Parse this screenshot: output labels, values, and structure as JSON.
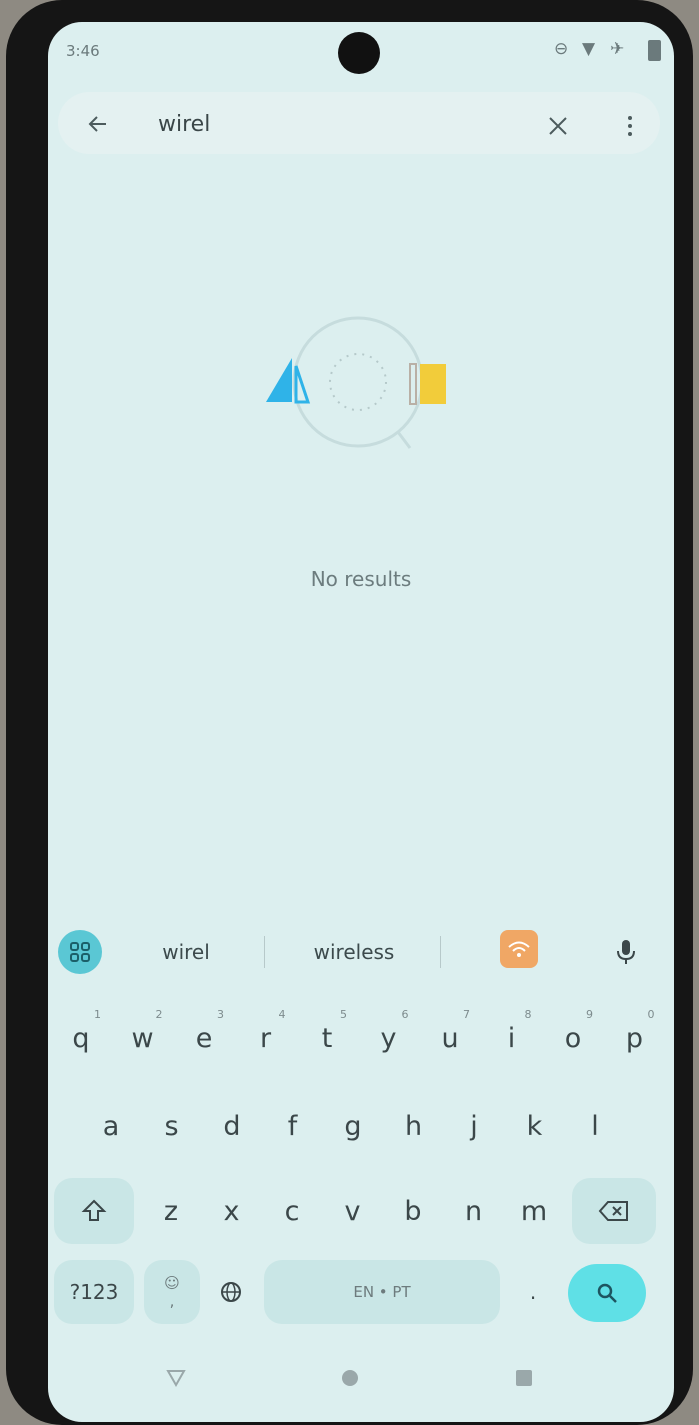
{
  "status": {
    "time": "3:46"
  },
  "search": {
    "value": "wirel",
    "placeholder": ""
  },
  "main": {
    "no_results": "No results"
  },
  "suggestions": {
    "items": [
      "wirel",
      "wireless"
    ]
  },
  "keyboard": {
    "row1": [
      {
        "k": "q",
        "hint": "1"
      },
      {
        "k": "w",
        "hint": "2"
      },
      {
        "k": "e",
        "hint": "3"
      },
      {
        "k": "r",
        "hint": "4"
      },
      {
        "k": "t",
        "hint": "5"
      },
      {
        "k": "y",
        "hint": "6"
      },
      {
        "k": "u",
        "hint": "7"
      },
      {
        "k": "i",
        "hint": "8"
      },
      {
        "k": "o",
        "hint": "9"
      },
      {
        "k": "p",
        "hint": "0"
      }
    ],
    "row2": [
      "a",
      "s",
      "d",
      "f",
      "g",
      "h",
      "j",
      "k",
      "l"
    ],
    "row3": [
      "z",
      "x",
      "c",
      "v",
      "b",
      "n",
      "m"
    ],
    "symbols_label": "?123",
    "comma_label": ",",
    "emoji_label": "☺",
    "space_label": "EN • PT",
    "period_label": "."
  },
  "colors": {
    "screen_bg": "#dcefef",
    "accent": "#5fe0e6",
    "wifi_chip": "#f0a765"
  },
  "icons": {
    "back": "arrow-left-icon",
    "clear": "close-icon",
    "more": "more-vertical-icon",
    "grid": "apps-grid-icon",
    "wifi": "wifi-icon",
    "mic": "microphone-icon",
    "shift": "shift-icon",
    "backspace": "backspace-icon",
    "globe": "globe-icon",
    "search": "search-icon",
    "nav_back": "triangle-back-icon",
    "nav_home": "circle-home-icon",
    "nav_recents": "square-recents-icon"
  }
}
